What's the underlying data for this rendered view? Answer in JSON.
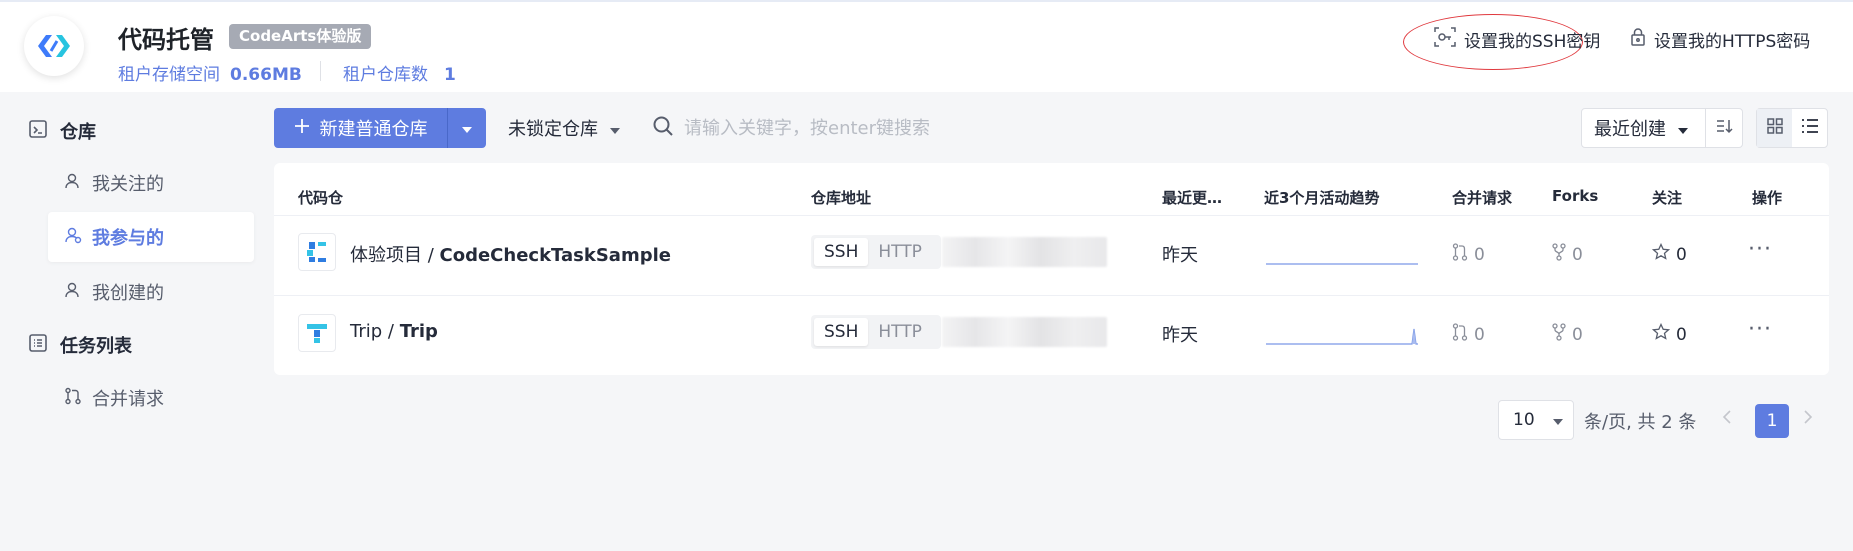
{
  "header": {
    "title": "代码托管",
    "badge": "CodeArts体验版",
    "storage_label": "租户存储空间",
    "storage_value": "0.66MB",
    "repo_count_label": "租户仓库数",
    "repo_count_value": "1",
    "ssh_link": "设置我的SSH密钥",
    "https_link": "设置我的HTTPS密码"
  },
  "sidebar": {
    "repo_group": "仓库",
    "items": [
      {
        "label": "我关注的"
      },
      {
        "label": "我参与的"
      },
      {
        "label": "我创建的"
      }
    ],
    "task_group": "任务列表",
    "task_items": [
      {
        "label": "合并请求"
      }
    ]
  },
  "toolbar": {
    "new_repo": "新建普通仓库",
    "lock_filter": "未锁定仓库",
    "search_placeholder": "请输入关键字，按enter键搜索",
    "sort": "最近创建"
  },
  "table": {
    "headers": [
      "代码仓",
      "仓库地址",
      "最近更…",
      "近3个月活动趋势",
      "合并请求",
      "Forks",
      "关注",
      "操作"
    ],
    "rows": [
      {
        "project": "体验项目 / ",
        "repo": "CodeCheckTaskSample",
        "ssh": "SSH",
        "http": "HTTP",
        "updated": "昨天",
        "merge_requests": "0",
        "forks": "0",
        "watchers": "0",
        "more": "···"
      },
      {
        "project": "Trip / ",
        "repo": "Trip",
        "ssh": "SSH",
        "http": "HTTP",
        "updated": "昨天",
        "merge_requests": "0",
        "forks": "0",
        "watchers": "0",
        "more": "···"
      }
    ]
  },
  "pagination": {
    "page_size": "10",
    "summary": "条/页, 共 2 条",
    "current_page": "1"
  },
  "colors": {
    "accent": "#5e7ce0",
    "highlight_circle": "#e0393e",
    "badge_bg": "#a6aab4"
  }
}
